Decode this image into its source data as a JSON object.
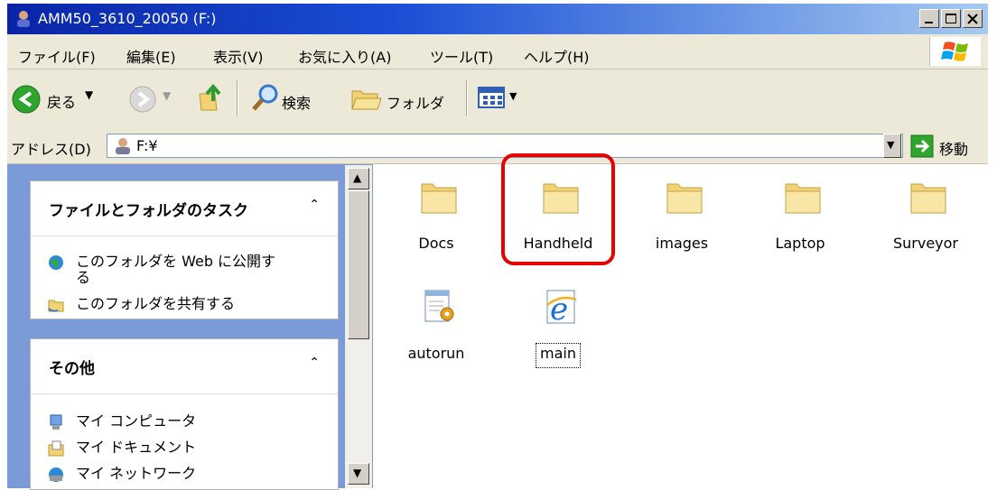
{
  "window": {
    "title": "AMM50_3610_20050 (F:)"
  },
  "menu": [
    "ファイル(F)",
    "編集(E)",
    "表示(V)",
    "お気に入り(A)",
    "ツール(T)",
    "ヘルプ(H)"
  ],
  "toolbar": {
    "back": "戻る",
    "search": "検索",
    "folders": "フォルダ"
  },
  "address": {
    "label": "アドレス(D)",
    "value": "F:¥",
    "go": "移動"
  },
  "tasks": {
    "title": "ファイルとフォルダのタスク",
    "items": [
      "このフォルダを Web に公開す\nる",
      "このフォルダを共有する"
    ]
  },
  "other": {
    "title": "その他",
    "items": [
      "マイ コンピュータ",
      "マイ ドキュメント",
      "マイ ネットワーク"
    ]
  },
  "files": [
    {
      "name": "Docs",
      "type": "folder"
    },
    {
      "name": "Handheld",
      "type": "folder"
    },
    {
      "name": "images",
      "type": "folder"
    },
    {
      "name": "Laptop",
      "type": "folder"
    },
    {
      "name": "Surveyor",
      "type": "folder"
    },
    {
      "name": "autorun",
      "type": "setup-info"
    },
    {
      "name": "main",
      "type": "html-ie"
    }
  ],
  "colors": {
    "highlight": "#e60000",
    "titlebar": "#0a24a6",
    "taskpane": "#7b9ad8"
  }
}
